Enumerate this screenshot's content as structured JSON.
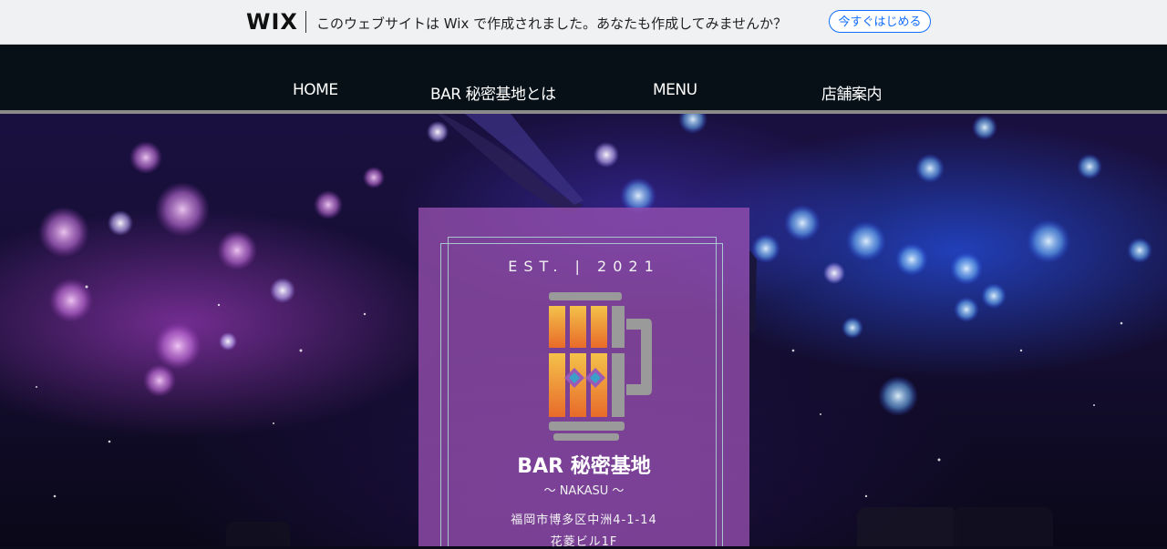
{
  "wix_banner": {
    "logo": "WIX",
    "message": "このウェブサイトは Wix で作成されました。あなたも作成してみませんか？",
    "cta_label": "今すぐはじめる"
  },
  "nav": {
    "items": [
      {
        "label": "HOME"
      },
      {
        "label": "BAR 秘密基地とは"
      },
      {
        "label": "MENU"
      },
      {
        "label": "店舗案内"
      }
    ]
  },
  "hero": {
    "est": "EST. | 2021",
    "name": "BAR 秘密基地",
    "subtitle": "～ NAKASU ～",
    "address_line1": "福岡市博多区中洲4-1-14",
    "address_line2": "花菱ビル1F"
  },
  "colors": {
    "nav_bg": "#071017",
    "card_bg": "#9650AF",
    "wix_accent": "#116dff",
    "logo_orange": "#f08a3c",
    "logo_blue": "#3aa0c8",
    "logo_gray": "#9a9a9a"
  },
  "icons": [
    "beer-mug-logo-icon"
  ]
}
